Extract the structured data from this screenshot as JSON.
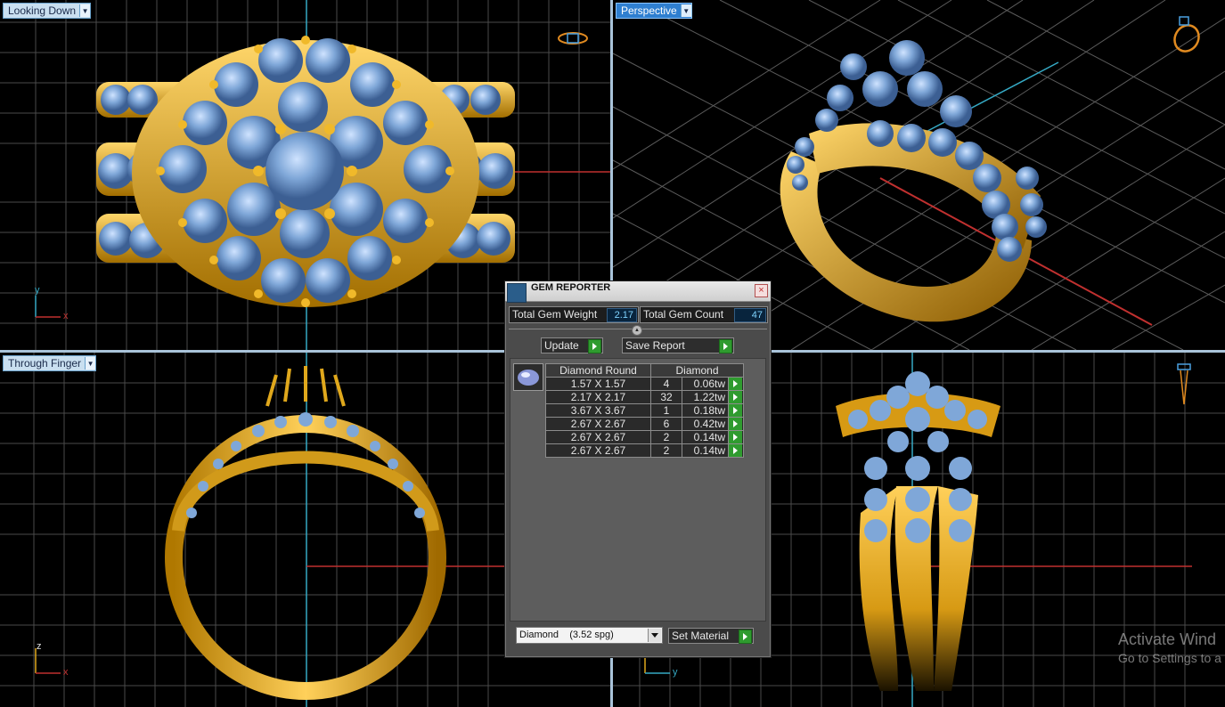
{
  "viewports": {
    "top_left": {
      "label": "Looking Down",
      "axes": [
        "y",
        "x"
      ]
    },
    "top_right": {
      "label": "Perspective"
    },
    "bottom_left": {
      "label": "Through Finger",
      "axes": [
        "z",
        "x"
      ]
    },
    "bottom_right": {
      "axes": [
        "z",
        "y"
      ]
    }
  },
  "gem_reporter": {
    "title": "GEM REPORTER",
    "total_weight_label": "Total Gem Weight",
    "total_weight": "2.17",
    "total_count_label": "Total Gem Count",
    "total_count": "47",
    "update_label": "Update",
    "save_report_label": "Save Report",
    "table": {
      "headers": [
        "Diamond Round",
        "Diamond"
      ],
      "rows": [
        {
          "size": "1.57 X 1.57",
          "count": "4",
          "weight": "0.06tw"
        },
        {
          "size": "2.17 X 2.17",
          "count": "32",
          "weight": "1.22tw"
        },
        {
          "size": "3.67 X 3.67",
          "count": "1",
          "weight": "0.18tw"
        },
        {
          "size": "2.67 X 2.67",
          "count": "6",
          "weight": "0.42tw"
        },
        {
          "size": "2.67 X 2.67",
          "count": "2",
          "weight": "0.14tw"
        },
        {
          "size": "2.67 X 2.67",
          "count": "2",
          "weight": "0.14tw"
        }
      ]
    },
    "material_value": "Diamond    (3.52 spg)",
    "set_material_label": "Set Material"
  },
  "watermark": {
    "line1": "Activate Wind",
    "line2": "Go to Settings to a"
  },
  "colors": {
    "gold": "#e0a81c",
    "gem": "#7fa7d8",
    "grid": "#555555",
    "axis_red": "#c0302f",
    "axis_cyan": "#35a9c4"
  }
}
